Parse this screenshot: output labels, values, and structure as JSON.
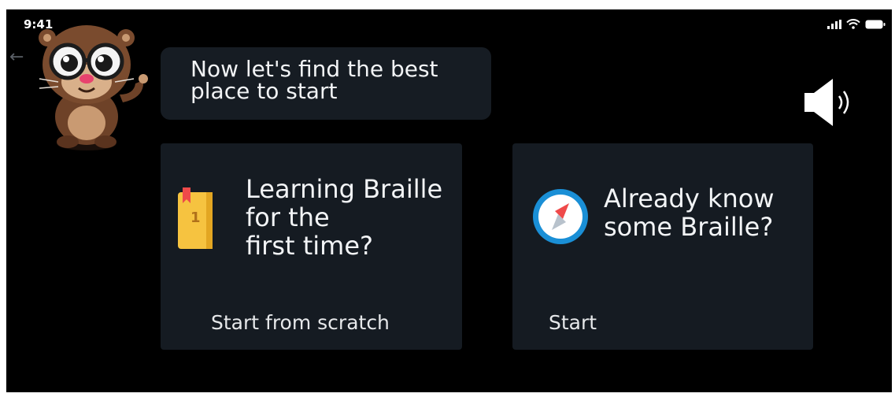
{
  "status_bar": {
    "time": "9:41"
  },
  "mascot": {
    "speech": "Now let's find the best place to start"
  },
  "options": [
    {
      "title": "Learning Braille\nfor the\nfirst time?",
      "action_label": "Start from scratch",
      "icon": "book-icon",
      "icon_badge": "1"
    },
    {
      "title": "Already know\nsome Braille?",
      "action_label": "Start",
      "icon": "compass-icon"
    }
  ],
  "colors": {
    "background": "#000000",
    "card": "#151b22",
    "bubble": "#161c23",
    "text": "#f2f4f6",
    "book": "#f6c340",
    "compass_ring": "#1a8fd6",
    "compass_needle": "#ef4a4a"
  }
}
